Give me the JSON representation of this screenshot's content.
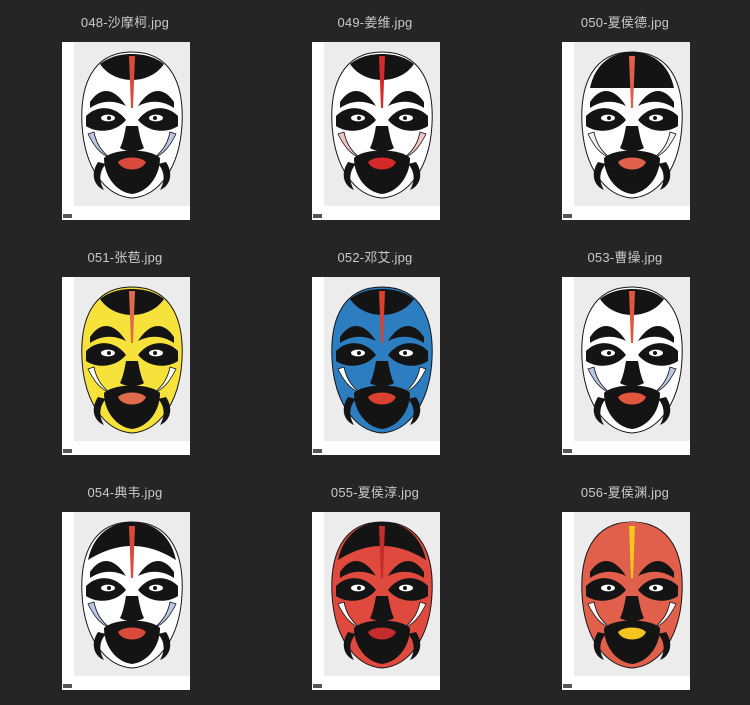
{
  "files": [
    {
      "name": "048-沙摩柯.jpg",
      "palette": {
        "base": "#ffffff",
        "dark": "#141414",
        "accent": "#d94a3a",
        "secondary": "#b9c7e6"
      }
    },
    {
      "name": "049-姜维.jpg",
      "palette": {
        "base": "#ffffff",
        "dark": "#141414",
        "accent": "#d42a2a",
        "secondary": "#f2c5c5"
      }
    },
    {
      "name": "050-夏侯德.jpg",
      "palette": {
        "base": "#ffffff",
        "dark": "#141414",
        "accent": "#e0604c",
        "secondary": "#f0f0f0"
      }
    },
    {
      "name": "051-张苞.jpg",
      "palette": {
        "base": "#f6e23a",
        "dark": "#141414",
        "accent": "#e06a4a",
        "secondary": "#ffffff"
      }
    },
    {
      "name": "052-邓艾.jpg",
      "palette": {
        "base": "#2d7ec0",
        "dark": "#141414",
        "accent": "#d9402e",
        "secondary": "#ffffff"
      }
    },
    {
      "name": "053-曹操.jpg",
      "palette": {
        "base": "#ffffff",
        "dark": "#141414",
        "accent": "#e2553f",
        "secondary": "#b9c7e6"
      }
    },
    {
      "name": "054-典韦.jpg",
      "palette": {
        "base": "#ffffff",
        "dark": "#141414",
        "accent": "#d94a3a",
        "secondary": "#b9c7e6"
      }
    },
    {
      "name": "055-夏侯淳.jpg",
      "palette": {
        "base": "#e04a3e",
        "dark": "#141414",
        "accent": "#c52c2c",
        "secondary": "#ffffff"
      }
    },
    {
      "name": "056-夏侯渊.jpg",
      "palette": {
        "base": "#e0604c",
        "dark": "#141414",
        "accent": "#f4c521",
        "secondary": "#ffffff"
      }
    }
  ]
}
